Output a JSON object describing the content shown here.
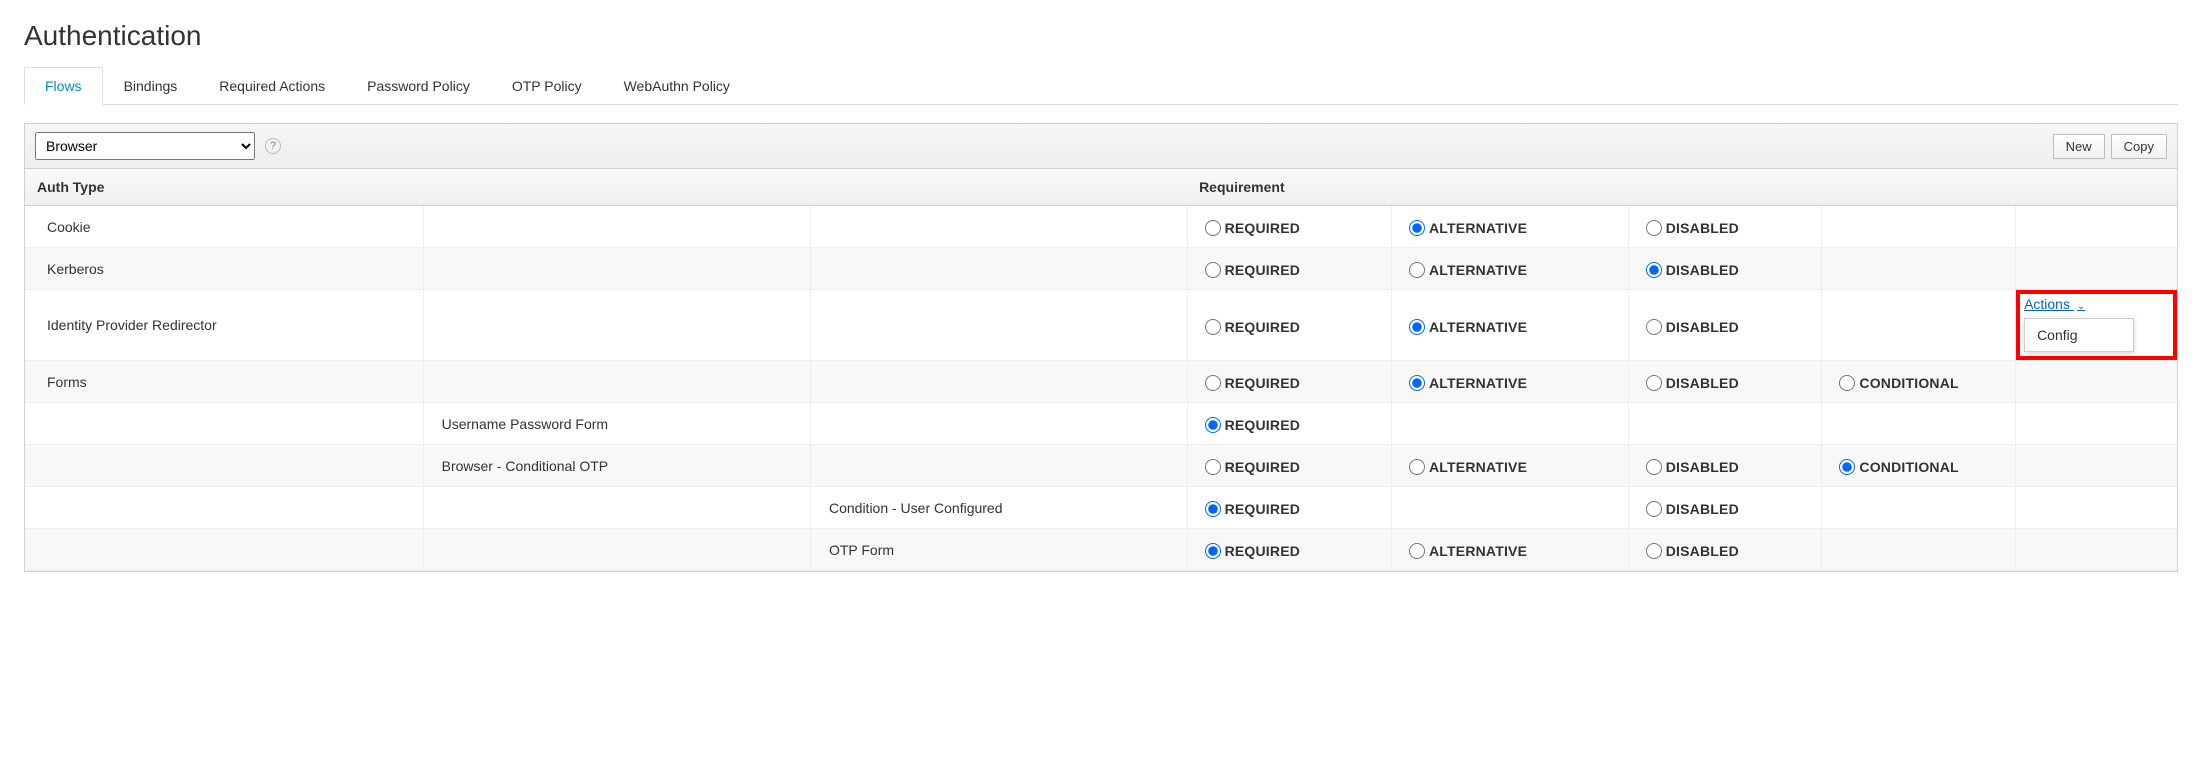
{
  "page_title": "Authentication",
  "tabs": [
    "Flows",
    "Bindings",
    "Required Actions",
    "Password Policy",
    "OTP Policy",
    "WebAuthn Policy"
  ],
  "active_tab": "Flows",
  "flow_select_value": "Browser",
  "buttons": {
    "new": "New",
    "copy": "Copy"
  },
  "columns": {
    "auth_type": "Auth Type",
    "requirement": "Requirement"
  },
  "radio_labels": {
    "required": "REQUIRED",
    "alternative": "ALTERNATIVE",
    "disabled": "DISABLED",
    "conditional": "CONDITIONAL"
  },
  "actions_label": "Actions",
  "actions_menu": [
    "Config"
  ],
  "rows": [
    {
      "level": 0,
      "name": "Cookie",
      "selected": "alternative",
      "opts": [
        "required",
        "alternative",
        "disabled"
      ]
    },
    {
      "level": 0,
      "name": "Kerberos",
      "selected": "disabled",
      "opts": [
        "required",
        "alternative",
        "disabled"
      ]
    },
    {
      "level": 0,
      "name": "Identity Provider Redirector",
      "selected": "alternative",
      "opts": [
        "required",
        "alternative",
        "disabled"
      ],
      "has_actions": true
    },
    {
      "level": 0,
      "name": "Forms",
      "selected": "alternative",
      "opts": [
        "required",
        "alternative",
        "disabled",
        "conditional"
      ]
    },
    {
      "level": 1,
      "name": "Username Password Form",
      "selected": "required",
      "opts": [
        "required"
      ]
    },
    {
      "level": 1,
      "name": "Browser - Conditional OTP",
      "selected": "conditional",
      "opts": [
        "required",
        "alternative",
        "disabled",
        "conditional"
      ]
    },
    {
      "level": 2,
      "name": "Condition - User Configured",
      "selected": "required",
      "opts": [
        "required",
        "disabled"
      ]
    },
    {
      "level": 2,
      "name": "OTP Form",
      "selected": "required",
      "opts": [
        "required",
        "alternative",
        "disabled"
      ]
    }
  ]
}
